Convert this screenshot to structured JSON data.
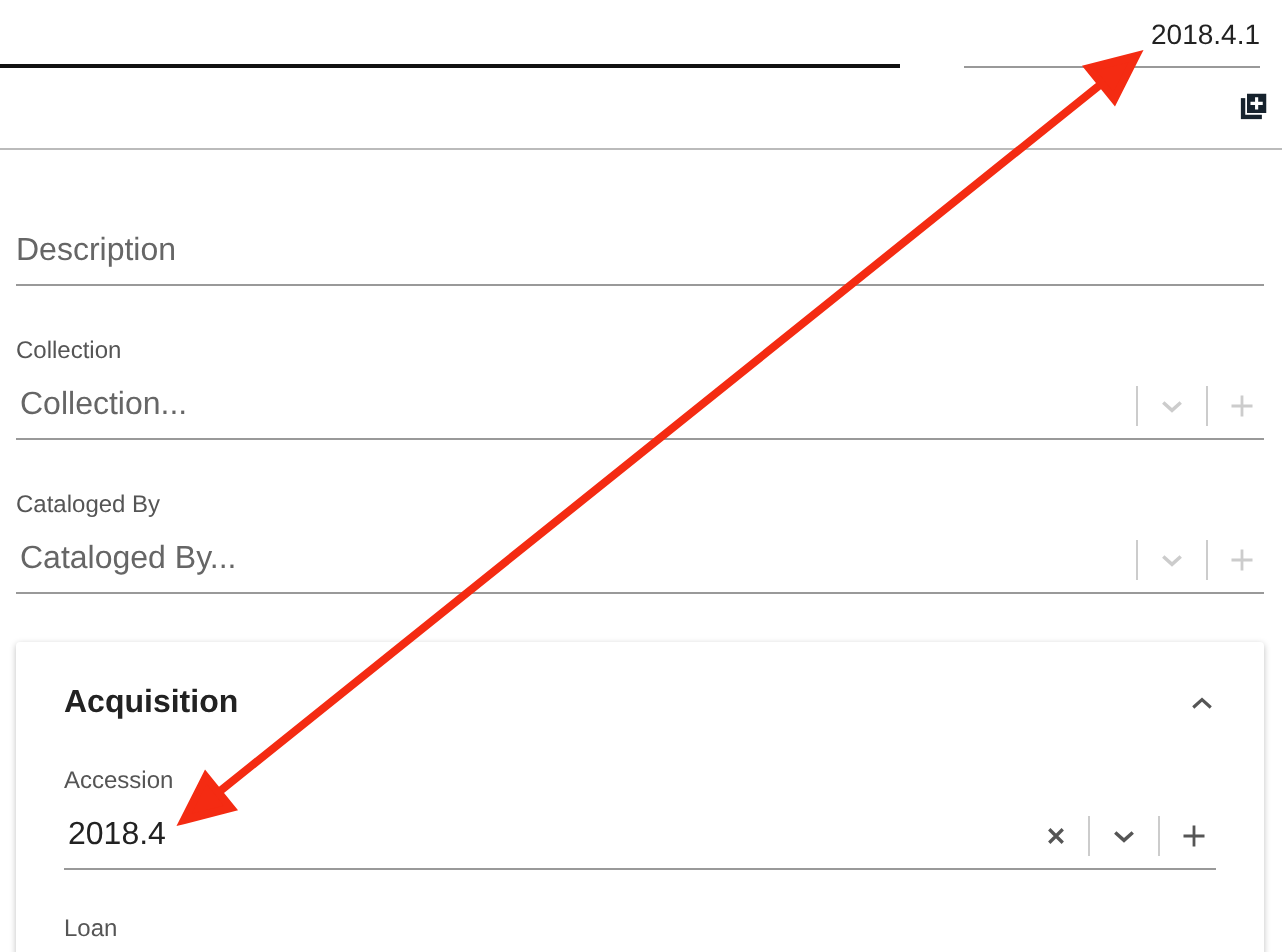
{
  "header": {
    "version_field": {
      "value": "2018.4.1"
    }
  },
  "description": {
    "placeholder": "Description"
  },
  "selects": [
    {
      "label": "Collection",
      "placeholder": "Collection...",
      "clearable": false
    },
    {
      "label": "Cataloged By",
      "placeholder": "Cataloged By...",
      "clearable": false
    }
  ],
  "acquisition_panel": {
    "title": "Acquisition",
    "expanded": true,
    "selects": [
      {
        "label": "Accession",
        "value": "2018.4",
        "clearable": true
      }
    ],
    "labels": [
      "Loan"
    ]
  }
}
